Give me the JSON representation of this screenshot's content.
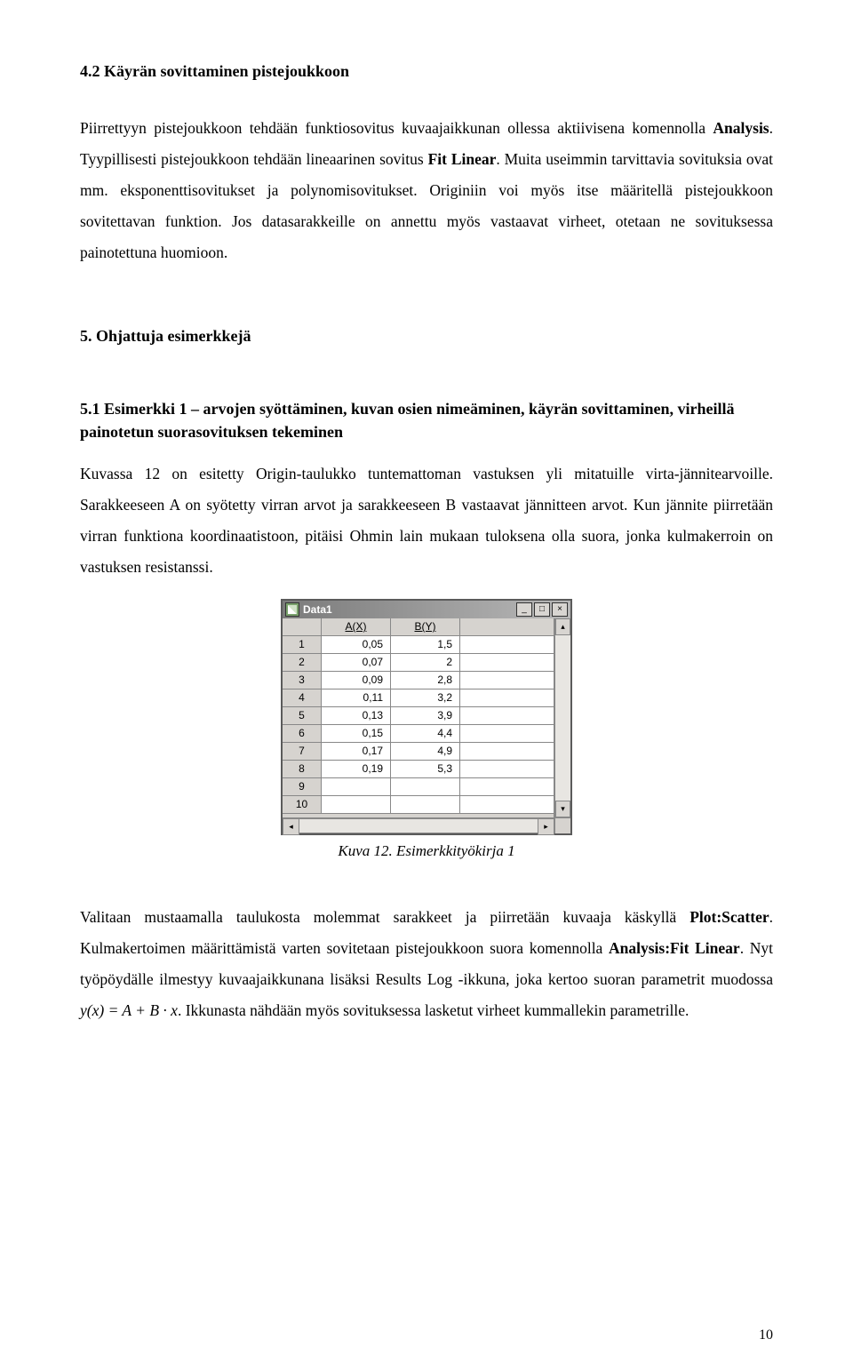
{
  "sec42_title": "4.2 Käyrän sovittaminen pistejoukkoon",
  "para1_a": "Piirrettyyn pistejoukkoon tehdään funktiosovitus kuvaajaikkunan ollessa aktiivisena komennolla ",
  "para1_b_bold": "Analysis",
  "para1_c": ". Tyypillisesti pistejoukkoon tehdään lineaarinen sovitus ",
  "para1_d_bold": "Fit Linear",
  "para1_e": ". Muita useimmin tarvittavia sovituksia ovat mm. eksponenttisovitukset ja polynomisovitukset. Originiin voi myös itse määritellä pistejoukkoon sovitettavan funktion. Jos datasarakkeille on annettu myös vastaavat virheet, otetaan ne sovituksessa painotettuna huomioon.",
  "sec5_title": "5. Ohjattuja esimerkkejä",
  "sub51_title": "5.1 Esimerkki 1 – arvojen syöttäminen, kuvan osien nimeäminen, käyrän sovittaminen, virheillä painotetun suorasovituksen tekeminen",
  "para2": "Kuvassa 12 on esitetty Origin-taulukko tuntemattoman vastuksen yli mitatuille virta-jännitearvoille. Sarakkeeseen A on syötetty virran arvot ja sarakkeeseen B vastaavat jännitteen arvot. Kun jännite piirretään virran funktiona koordinaatistoon, pitäisi Ohmin lain mukaan tuloksena olla suora, jonka kulmakerroin on vastuksen resistanssi.",
  "win_title": "Data1",
  "colA_header": "A(X)",
  "colB_header": "B(Y)",
  "rows": [
    {
      "n": "1",
      "a": "0,05",
      "b": "1,5"
    },
    {
      "n": "2",
      "a": "0,07",
      "b": "2"
    },
    {
      "n": "3",
      "a": "0,09",
      "b": "2,8"
    },
    {
      "n": "4",
      "a": "0,11",
      "b": "3,2"
    },
    {
      "n": "5",
      "a": "0,13",
      "b": "3,9"
    },
    {
      "n": "6",
      "a": "0,15",
      "b": "4,4"
    },
    {
      "n": "7",
      "a": "0,17",
      "b": "4,9"
    },
    {
      "n": "8",
      "a": "0,19",
      "b": "5,3"
    },
    {
      "n": "9",
      "a": "",
      "b": ""
    },
    {
      "n": "10",
      "a": "",
      "b": ""
    }
  ],
  "caption": "Kuva 12. Esimerkkityökirja 1",
  "para3_a": "Valitaan mustaamalla taulukosta molemmat sarakkeet ja piirretään kuvaaja käskyllä ",
  "para3_b_bold": "Plot:Scatter",
  "para3_c": ". Kulmakertoimen määrittämistä varten sovitetaan pistejoukkoon suora komennolla ",
  "para3_d_bold": "Analysis:Fit Linear",
  "para3_e": ". Nyt työpöydälle ilmestyy kuvaajaikkunana lisäksi Results Log -ikkuna, joka kertoo suoran parametrit muodossa ",
  "para3_formula": "y(x) = A + B · x",
  "para3_f": ". Ikkunasta nähdään myös sovituksessa lasketut virheet kummallekin parametrille.",
  "page_number": "10",
  "tb_min": "_",
  "tb_max": "□",
  "tb_close": "×",
  "arrow_up": "▴",
  "arrow_down": "▾",
  "arrow_left": "◂",
  "arrow_right": "▸",
  "chart_data": {
    "type": "table",
    "title": "Data1",
    "columns": [
      "A(X)",
      "B(Y)"
    ],
    "series": [
      {
        "name": "A(X)",
        "values": [
          0.05,
          0.07,
          0.09,
          0.11,
          0.13,
          0.15,
          0.17,
          0.19
        ]
      },
      {
        "name": "B(Y)",
        "values": [
          1.5,
          2,
          2.8,
          3.2,
          3.9,
          4.4,
          4.9,
          5.3
        ]
      }
    ]
  }
}
